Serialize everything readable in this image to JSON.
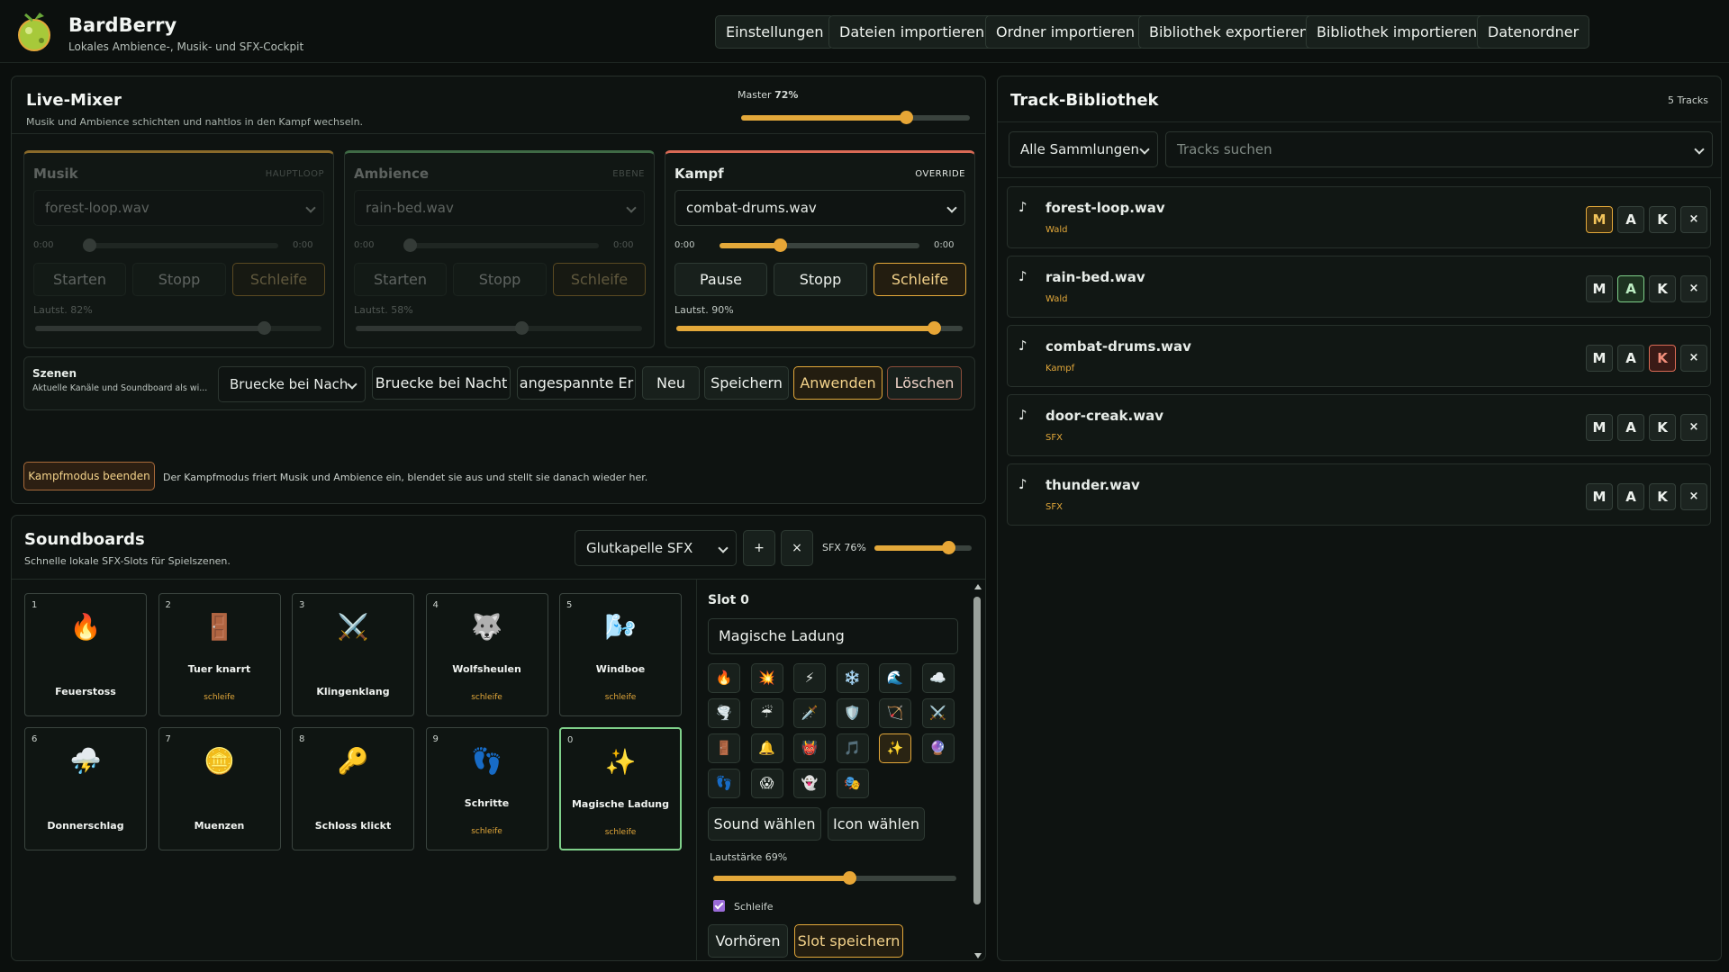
{
  "app": {
    "title": "BardBerry",
    "subtitle": "Lokales Ambience-, Musik- und SFX-Cockpit"
  },
  "topbar": [
    "Einstellungen",
    "Dateien importieren",
    "Ordner importieren",
    "Bibliothek exportieren",
    "Bibliothek importieren",
    "Datenordner"
  ],
  "mixer": {
    "title": "Live-Mixer",
    "subtitle": "Musik und Ambience schichten und nahtlos in den Kampf wechseln.",
    "master_label": "Master",
    "master_value": "72%",
    "master_level": 0.72,
    "channels": [
      {
        "name": "Musik",
        "tag": "HAUPTLOOP",
        "file": "forest-loop.wav",
        "time_start": "0:00",
        "time_end": "0:00",
        "btn_play": "Starten",
        "btn_stop": "Stopp",
        "btn_loop": "Schleife",
        "volume_label": "Lautst. 82%",
        "volume": 0.82,
        "color": "#8a6a2a"
      },
      {
        "name": "Ambience",
        "tag": "EBENE",
        "file": "rain-bed.wav",
        "time_start": "0:00",
        "time_end": "0:00",
        "btn_play": "Starten",
        "btn_stop": "Stopp",
        "btn_loop": "Schleife",
        "volume_label": "Lautst. 58%",
        "volume": 0.58,
        "color": "#3f6a45"
      },
      {
        "name": "Kampf",
        "tag": "OVERRIDE",
        "file": "combat-drums.wav",
        "time_start": "0:00",
        "time_end": "0:00",
        "btn_play": "Pause",
        "btn_stop": "Stopp",
        "btn_loop": "Schleife",
        "volume_label": "Lautst. 90%",
        "volume": 0.9,
        "color": "#d96a55"
      }
    ],
    "scenes": {
      "title": "Szenen",
      "subtitle": "Aktuelle Kanäle und Soundboard als wi...",
      "select": "Bruecke bei Nach",
      "name_input": "Bruecke bei Nacht",
      "desc_input": "angespannte Er",
      "btn_new": "Neu",
      "btn_save": "Speichern",
      "btn_apply": "Anwenden",
      "btn_delete": "Löschen"
    },
    "combat_button": "Kampfmodus beenden",
    "combat_note": "Der Kampfmodus friert Musik und Ambience ein, blendet sie aus und stellt sie danach wieder her."
  },
  "soundboards": {
    "title": "Soundboards",
    "subtitle": "Schnelle lokale SFX-Slots für Spielszenen.",
    "select": "Glutkapelle SFX",
    "add": "+",
    "remove": "×",
    "sfx_label": "SFX 76%",
    "sfx_level": 0.76,
    "loop_text": "schleife",
    "tiles": [
      {
        "num": "1",
        "emoji": "🔥",
        "label": "Feuerstoss",
        "loop": false
      },
      {
        "num": "2",
        "emoji": "🚪",
        "label": "Tuer knarrt",
        "loop": true
      },
      {
        "num": "3",
        "emoji": "⚔️",
        "label": "Klingenklang",
        "loop": false
      },
      {
        "num": "4",
        "emoji": "🐺",
        "label": "Wolfsheulen",
        "loop": true
      },
      {
        "num": "5",
        "emoji": "🌬️",
        "label": "Windboe",
        "loop": true
      },
      {
        "num": "6",
        "emoji": "⛈️",
        "label": "Donnerschlag",
        "loop": false
      },
      {
        "num": "7",
        "emoji": "🪙",
        "label": "Muenzen",
        "loop": false
      },
      {
        "num": "8",
        "emoji": "🔑",
        "label": "Schloss klickt",
        "loop": false
      },
      {
        "num": "9",
        "emoji": "👣",
        "label": "Schritte",
        "loop": true
      },
      {
        "num": "0",
        "emoji": "✨",
        "label": "Magische Ladung",
        "loop": true
      }
    ],
    "slot": {
      "title": "Slot 0",
      "name": "Magische Ladung",
      "icons": [
        "🔥",
        "💥",
        "⚡",
        "❄️",
        "🌊",
        "☁️",
        "🌪️",
        "☔",
        "🗡️",
        "🛡️",
        "🏹",
        "⚔️",
        "🚪",
        "🔔",
        "👹",
        "🎵",
        "✨",
        "🔮",
        "👣",
        "😱",
        "👻",
        "🎭"
      ],
      "selected_icon": 16,
      "btn_sound": "Sound wählen",
      "btn_icon": "Icon wählen",
      "volume_label": "Lautstärke 69%",
      "volume": 0.69,
      "loop_label": "Schleife",
      "btn_preview": "Vorhören",
      "btn_save": "Slot speichern"
    }
  },
  "library": {
    "title": "Track-Bibliothek",
    "count": "5 Tracks",
    "collection_select": "Alle Sammlungen",
    "search_placeholder": "Tracks suchen",
    "tracks": [
      {
        "name": "forest-loop.wav",
        "collection": "Wald",
        "active": "M"
      },
      {
        "name": "rain-bed.wav",
        "collection": "Wald",
        "active": "A"
      },
      {
        "name": "combat-drums.wav",
        "collection": "Kampf",
        "active": "K"
      },
      {
        "name": "door-creak.wav",
        "collection": "SFX",
        "active": ""
      },
      {
        "name": "thunder.wav",
        "collection": "SFX",
        "active": ""
      }
    ],
    "btn_m": "M",
    "btn_a": "A",
    "btn_k": "K",
    "btn_x": "×"
  }
}
